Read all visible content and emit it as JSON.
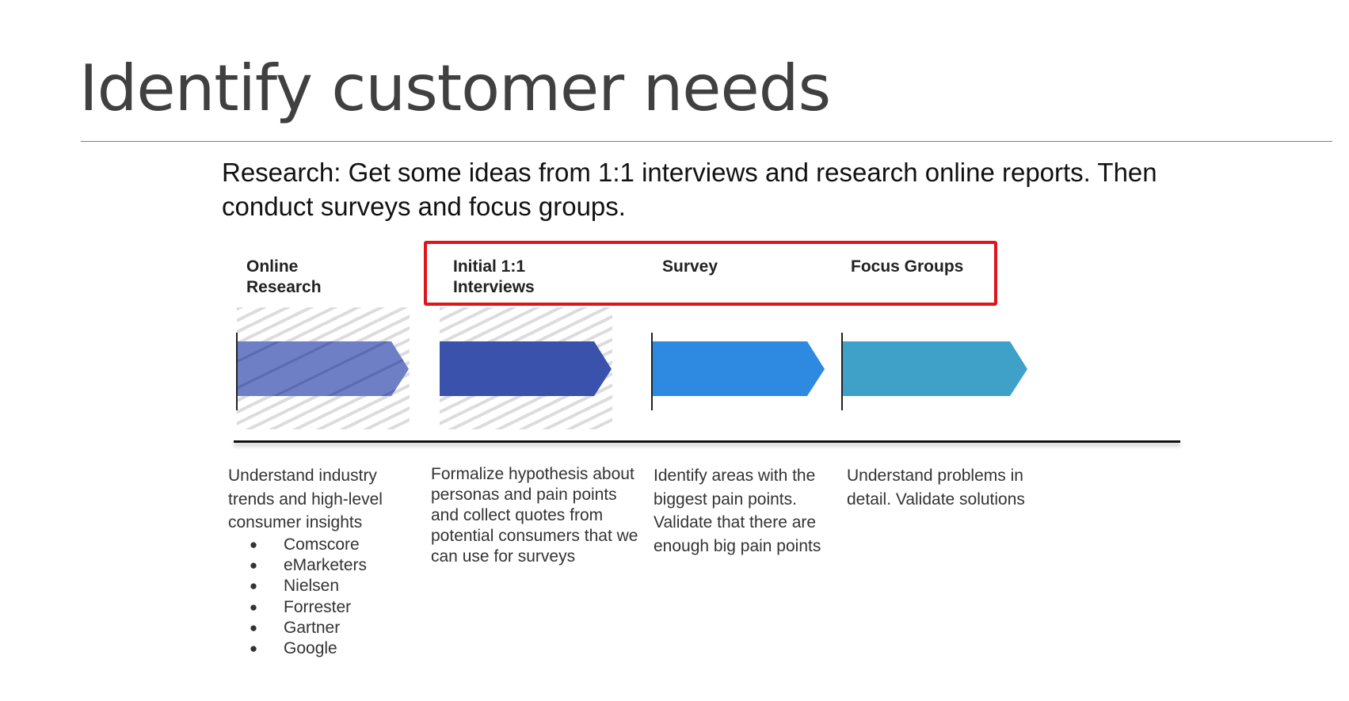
{
  "title": "Identify customer needs",
  "intro": "Research: Get some ideas from 1:1 interviews and research online reports. Then conduct surveys and focus groups.",
  "colors": {
    "highlight_border": "#e0141b",
    "online_research": "#6f7fc6",
    "interviews": "#3b52ad",
    "survey": "#2e8ae0",
    "focus_groups": "#3fa0c8"
  },
  "phases": [
    {
      "title_lines": [
        "Online",
        "Research"
      ],
      "description": "Understand industry trends and high-level consumer insights",
      "sources": [
        "Comscore",
        "eMarketers",
        "Nielsen",
        "Forrester",
        "Gartner",
        "Google"
      ]
    },
    {
      "title_lines": [
        "Initial 1:1",
        "Interviews"
      ],
      "description": "Formalize hypothesis about personas and pain points and collect quotes from potential consumers that we can use for surveys"
    },
    {
      "title_lines": [
        "Survey"
      ],
      "description": "Identify areas with the biggest pain points. Validate that there are enough big pain points"
    },
    {
      "title_lines": [
        "Focus Groups"
      ],
      "description": "Understand problems in detail. Validate solutions"
    }
  ],
  "bullet_glyph": "●"
}
